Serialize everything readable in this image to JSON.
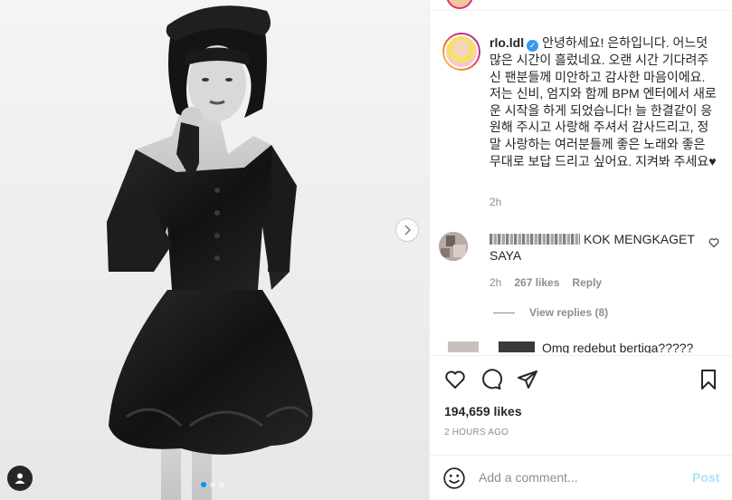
{
  "post": {
    "username": "rlo.ldl",
    "caption": "안녕하세요! 은하입니다. 어느덧 많은 시간이 흘렀네요. 오랜 시간 기다려주신 팬분들께 미안하고 감사한 마음이에요. 저는 신비, 엄지와 함께 BPM 엔터에서 새로운 시작을 하게 되었습니다! 늘 한결같이 응원해 주시고 사랑해 주셔서 감사드리고, 정말 사랑하는 여러분들께 좋은 노래와 좋은 무대로 보답 드리고 싶어요. 지켜봐 주세요♥",
    "caption_time": "2h",
    "likes": "194,659 likes",
    "posted": "2 HOURS AGO"
  },
  "comments": [
    {
      "text": "KOK MENGKAGET SAYA",
      "time": "2h",
      "likes": "267 likes",
      "reply": "Reply",
      "view_replies": "View replies (8)"
    },
    {
      "text": "Omg redebut bertiga?????"
    }
  ],
  "composer": {
    "placeholder": "Add a comment...",
    "post_label": "Post"
  },
  "carousel": {
    "count": 3,
    "active_index": 0
  },
  "colors": {
    "accent": "#0095f6",
    "verified": "#3897f0",
    "muted": "#8e8e8e",
    "post_disabled": "#b2dffc"
  }
}
